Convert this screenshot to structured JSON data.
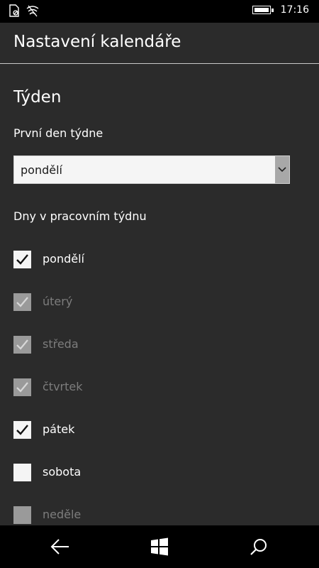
{
  "status_bar": {
    "time": "17:16",
    "icons": [
      "no-sim-icon",
      "wifi-icon",
      "battery-icon"
    ]
  },
  "header": {
    "title": "Nastavení kalendáře"
  },
  "week_section": {
    "title": "Týden",
    "first_day_label": "První den týdne",
    "first_day_value": "pondělí",
    "workdays_label": "Dny v pracovním týdnu",
    "days": [
      {
        "label": "pondělí",
        "checked": true,
        "enabled": true
      },
      {
        "label": "úterý",
        "checked": true,
        "enabled": false
      },
      {
        "label": "středa",
        "checked": true,
        "enabled": false
      },
      {
        "label": "čtvrtek",
        "checked": true,
        "enabled": false
      },
      {
        "label": "pátek",
        "checked": true,
        "enabled": true
      },
      {
        "label": "sobota",
        "checked": false,
        "enabled": true
      },
      {
        "label": "neděle",
        "checked": false,
        "enabled": false
      }
    ]
  },
  "navbar": {
    "icons": [
      "back-icon",
      "windows-icon",
      "search-icon"
    ]
  }
}
